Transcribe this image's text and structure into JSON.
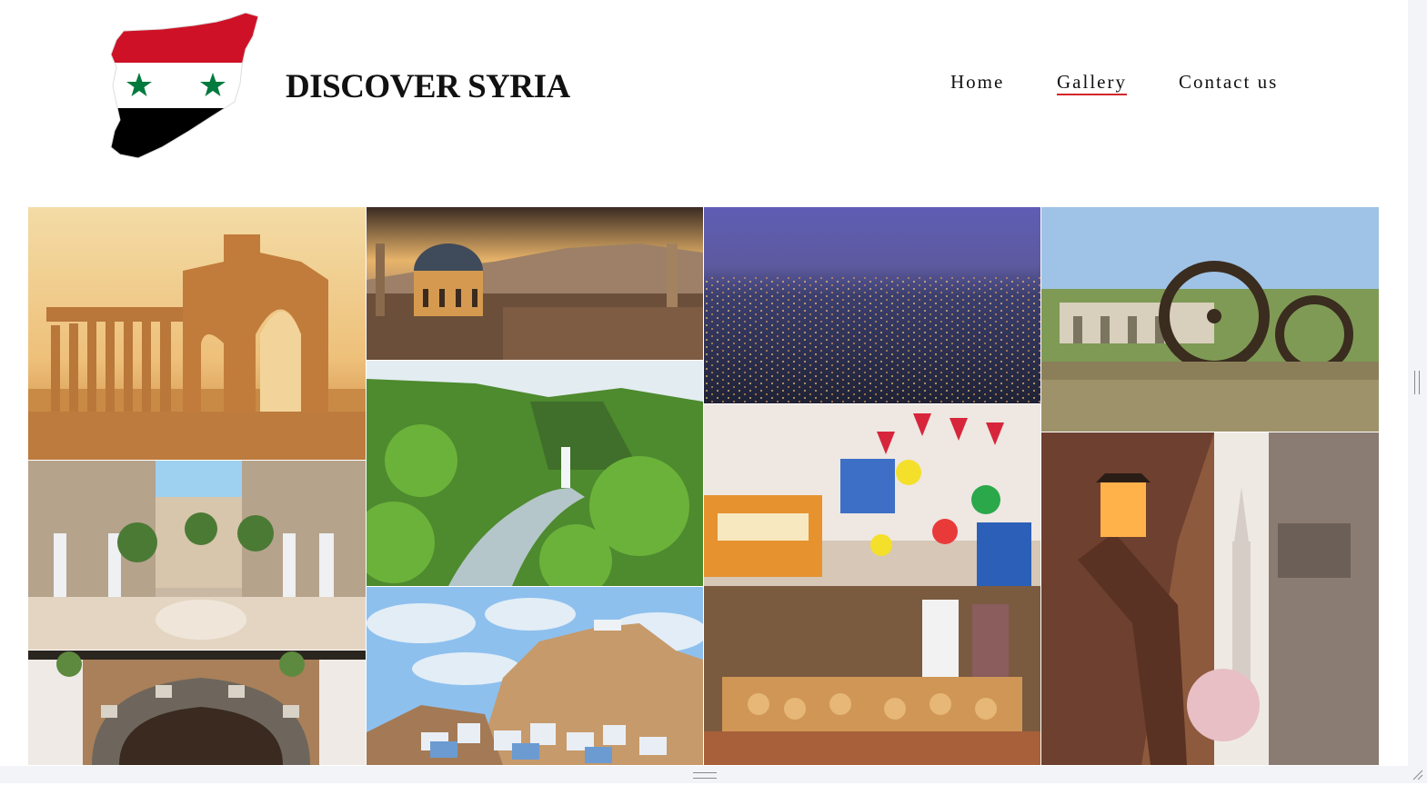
{
  "header": {
    "site_title": "DISCOVER SYRIA"
  },
  "nav": {
    "items": [
      {
        "label": "Home",
        "active": false
      },
      {
        "label": "Gallery",
        "active": true
      },
      {
        "label": "Contact us",
        "active": false
      }
    ]
  },
  "colors": {
    "flag_red": "#ce1126",
    "flag_green": "#007a3d",
    "accent_underline": "#d3262b"
  },
  "gallery": {
    "photos": [
      "palmyra-ruins",
      "damascus-mosque-skyline",
      "damascus-night-cityscape",
      "hama-waterwheels",
      "damascene-house-courtyard",
      "green-valley-waterfall",
      "souq-market-lanterns",
      "old-city-alley-lamp",
      "stone-arch-doorway",
      "maaloula-cliff-village"
    ]
  }
}
